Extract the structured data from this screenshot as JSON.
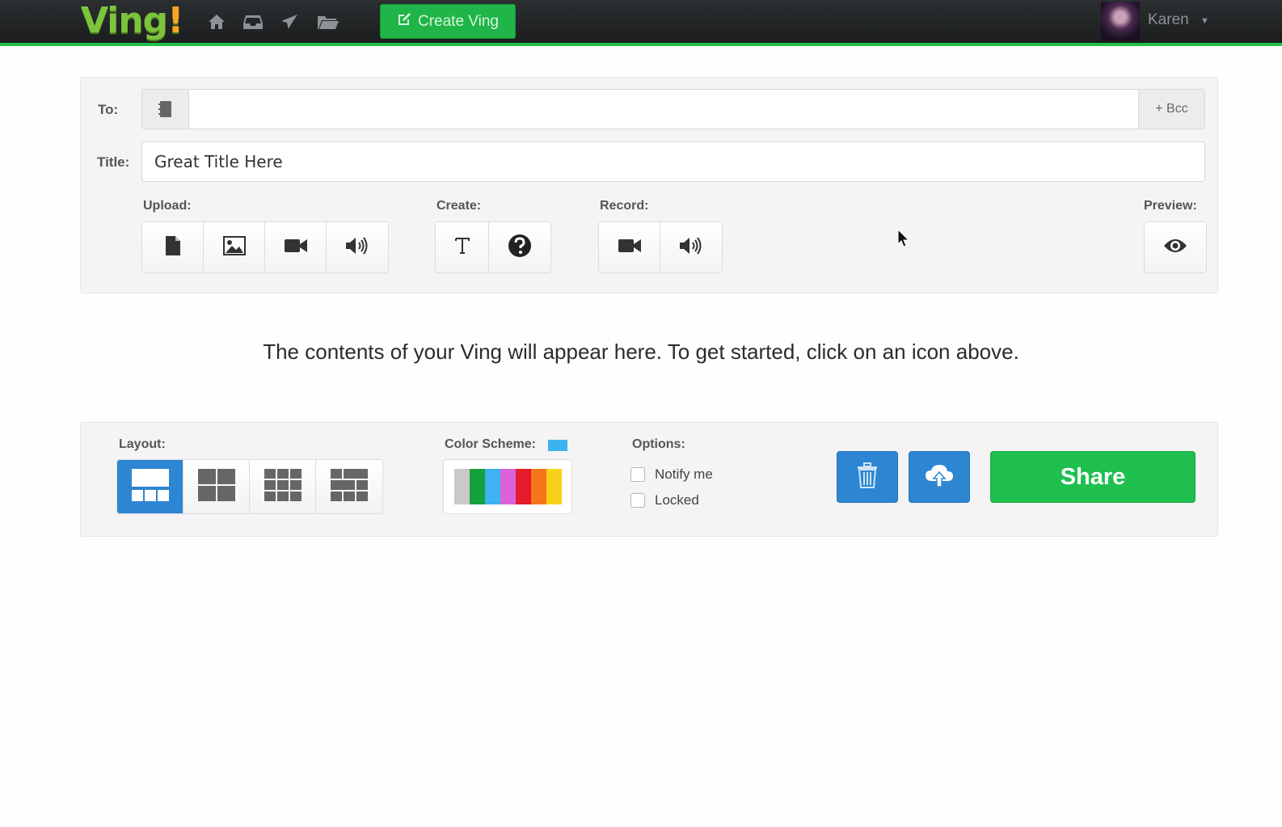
{
  "app": {
    "logo_text": "Ving",
    "logo_suffix": "!"
  },
  "topbar": {
    "nav_icons": [
      "home-icon",
      "inbox-icon",
      "send-icon",
      "folder-icon"
    ],
    "create_button_label": "Create Ving",
    "user_name": "Karen"
  },
  "compose": {
    "to_label": "To:",
    "to_value": "",
    "bcc_label": "+ Bcc",
    "title_label": "Title:",
    "title_value": "Great Title Here",
    "upload_label": "Upload:",
    "upload_buttons": [
      "document-icon",
      "image-icon",
      "video-icon",
      "audio-icon"
    ],
    "create_label": "Create:",
    "create_buttons": [
      "text-icon",
      "question-icon"
    ],
    "record_label": "Record:",
    "record_buttons": [
      "video-icon",
      "audio-icon"
    ],
    "preview_label": "Preview:",
    "preview_button": "eye-icon"
  },
  "content": {
    "placeholder": "The contents of your Ving will appear here. To get started, click on an icon above."
  },
  "settings": {
    "layout_label": "Layout:",
    "layouts": [
      "layout-banner",
      "layout-2x2",
      "layout-3x3",
      "layout-mixed"
    ],
    "selected_layout": "layout-banner",
    "color_scheme_label": "Color Scheme:",
    "color_scheme_swatch": "#3db3f0",
    "color_scheme_colors": [
      "#c9c9c9",
      "#14a03c",
      "#3db3f0",
      "#d962d9",
      "#e31b2b",
      "#f5761a",
      "#f8d11a"
    ],
    "options_label": "Options:",
    "options": [
      {
        "label": "Notify me",
        "checked": false
      },
      {
        "label": "Locked",
        "checked": false
      }
    ],
    "delete_button": "trash-icon",
    "upload_button": "cloud-upload-icon",
    "share_label": "Share"
  },
  "colors": {
    "accent_green": "#1fbf50",
    "accent_blue": "#2d86d1",
    "topbar_border": "#22c04a"
  }
}
